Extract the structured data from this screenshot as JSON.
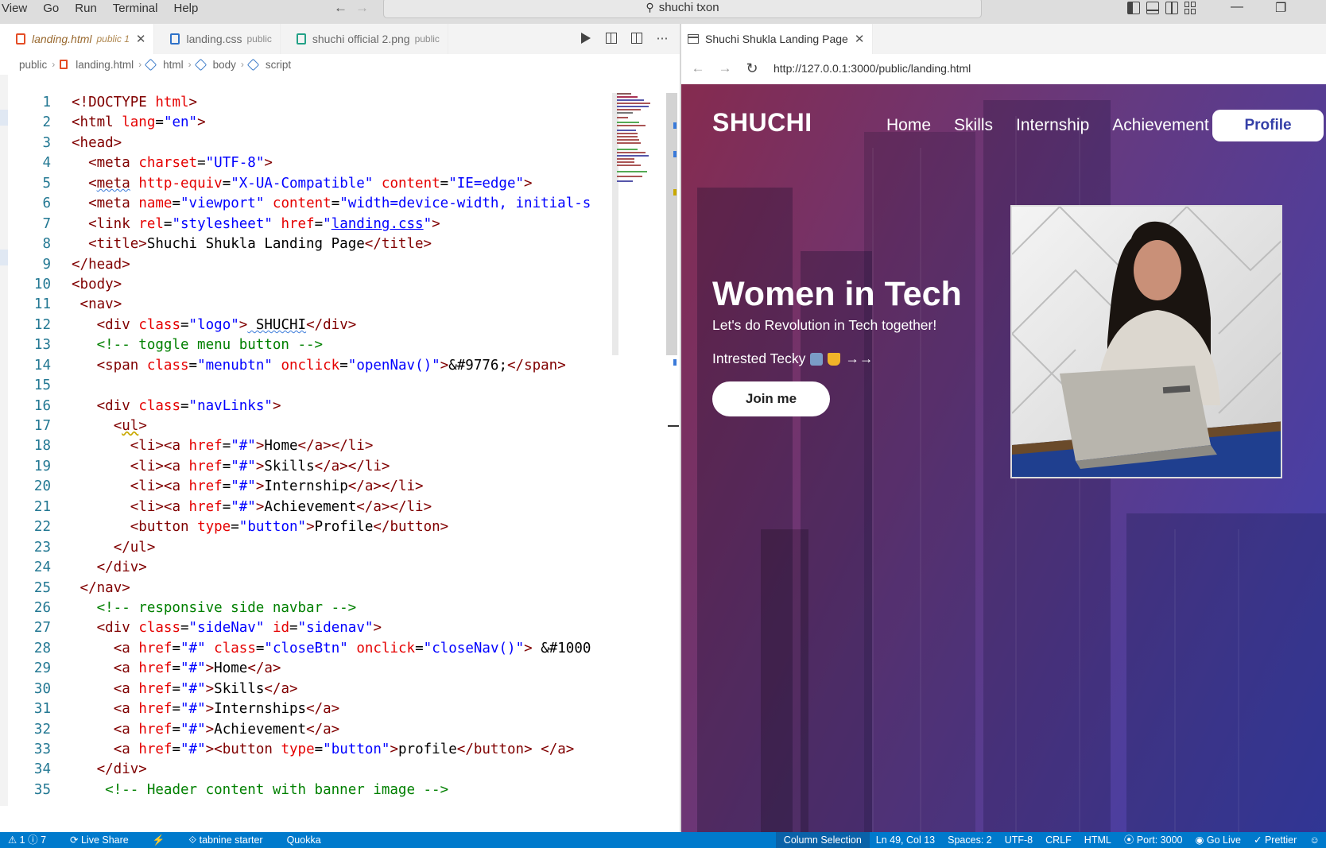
{
  "menu": {
    "items": [
      "View",
      "Go",
      "Run",
      "Terminal",
      "Help"
    ]
  },
  "titlebar": {
    "back_icon": "arrow-left-icon",
    "forward_icon": "arrow-right-icon",
    "search_text": "shuchi txon"
  },
  "editor": {
    "tabs": [
      {
        "name": "landing.html",
        "desc": "public 1",
        "icon": "html5-icon",
        "active": true
      },
      {
        "name": "landing.css",
        "desc": "public",
        "icon": "css3-icon",
        "active": false
      },
      {
        "name": "shuchi official 2.png",
        "desc": "public",
        "icon": "image-icon",
        "active": false
      }
    ],
    "breadcrumb": [
      "public",
      "landing.html",
      "html",
      "body",
      "script"
    ],
    "line_numbers": [
      "1",
      "2",
      "3",
      "4",
      "5",
      "6",
      "7",
      "8",
      "9",
      "10",
      "11",
      "12",
      "13",
      "14",
      "15",
      "16",
      "17",
      "18",
      "19",
      "20",
      "21",
      "22",
      "23",
      "24",
      "25",
      "26",
      "27",
      "28",
      "29",
      "30",
      "31",
      "32",
      "33",
      "34",
      "35"
    ],
    "code": {
      "l1_doctype": "<!DOCTYPE",
      "l1_html": "html",
      "l6_content": "width=device-width, initial-s",
      "l7_href": "landing.css",
      "l8_title": "Shuchi Shukla Landing Page",
      "l12_logo": " SHUCHI",
      "l13_comment": "<!-- toggle menu button -->",
      "l14_onclick": "openNav()",
      "l14_entity": "&#9776;",
      "l16_class": "navLinks",
      "l18_text": "Home",
      "l19_text": "Skills",
      "l20_text": "Internship",
      "l21_text": "Achievement",
      "l22_text": "Profile",
      "l26_comment": "<!-- responsive side navbar -->",
      "l27_class": "sideNav",
      "l27_id": "sidenav",
      "l28_class": "closeBtn",
      "l28_onclick": "closeNav()",
      "l28_entity": " &#1000",
      "l29_text": "Home",
      "l30_text": "Skills",
      "l31_text": "Internships",
      "l32_text": "Achievement",
      "l33_text": "profile",
      "l35_comment": "<!-- Header content with banner image -->"
    }
  },
  "browser": {
    "tab_title": "Shuchi Shukla Landing Page",
    "url": "http://127.0.0.1:3000/public/landing.html",
    "site": {
      "logo": "SHUCHI",
      "nav_links": [
        "Home",
        "Skills",
        "Internship",
        "Achievement"
      ],
      "profile_button": "Profile",
      "hero_title": "Women in Tech",
      "hero_subtitle": "Let's do Revolution in Tech together!",
      "hero_line": "Intrested Tecky",
      "hero_line_arrows": "→→",
      "join_button": "Join me"
    }
  },
  "statusbar": {
    "problems": "⚠ 1 ⓘ 7",
    "left_items": [
      "Live Share",
      "tabnine starter",
      "Quokka"
    ],
    "right_items": [
      "Column Selection",
      "Ln 49, Col 13",
      "Spaces: 2",
      "UTF-8",
      "CRLF",
      "HTML",
      "Port: 3000",
      "Go Live",
      "Prettier"
    ]
  },
  "colors": {
    "statusbar": "#007acc",
    "tag": "#800000",
    "attribute": "#e50000",
    "value": "#0000ff",
    "comment": "#008000",
    "line_number": "#237893",
    "hero_gradient_left": "#78143c",
    "hero_gradient_right": "#282daa"
  }
}
